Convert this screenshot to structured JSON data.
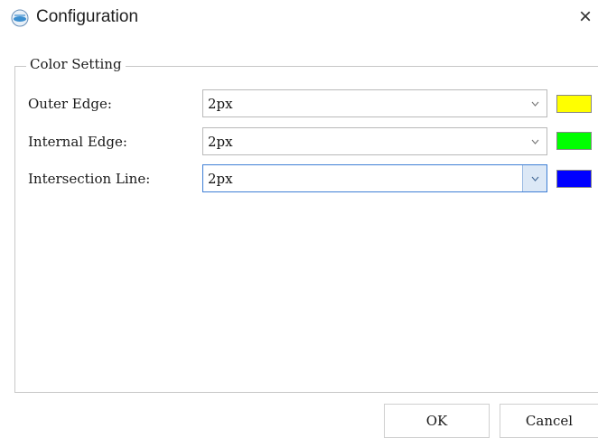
{
  "window": {
    "title": "Configuration",
    "app_icon": "app-logo-icon",
    "close_icon": "close-icon"
  },
  "group": {
    "label": "Color Setting"
  },
  "rows": [
    {
      "label": "Outer Edge:",
      "value": "2px",
      "color": "#ffff00"
    },
    {
      "label": "Internal Edge:",
      "value": "2px",
      "color": "#00ff00"
    },
    {
      "label": "Intersection Line:",
      "value": "2px",
      "color": "#0000ff"
    }
  ],
  "buttons": {
    "ok": "OK",
    "cancel": "Cancel"
  }
}
